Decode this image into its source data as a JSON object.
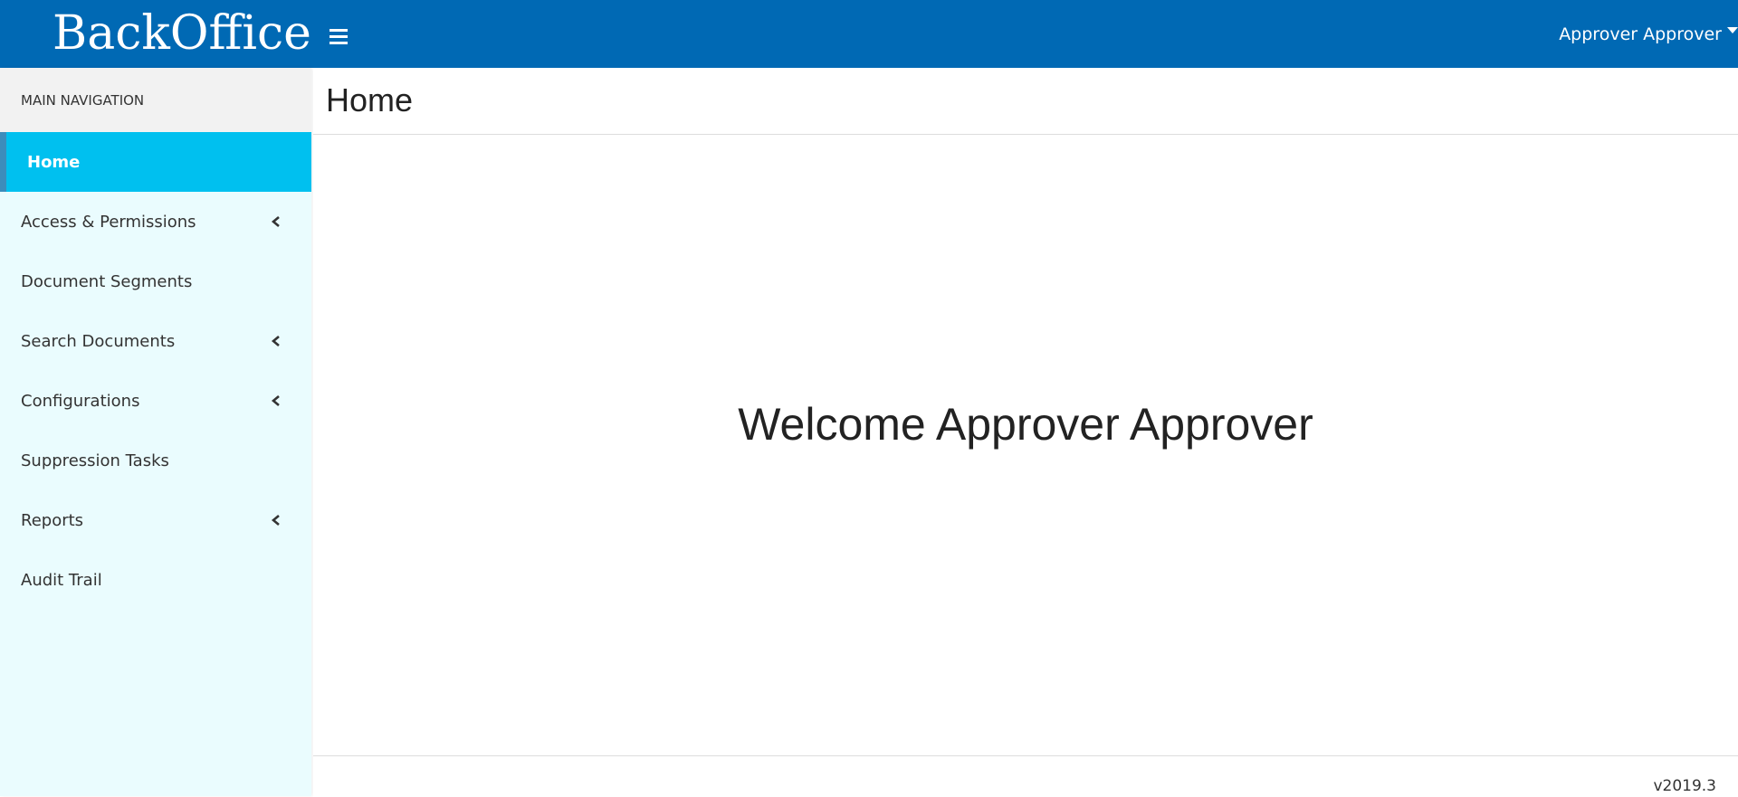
{
  "app": {
    "brand": "BackOffice",
    "user_name": "Approver Approver"
  },
  "colors": {
    "topbar": "#0069b4",
    "sidebar_bg": "#eafcfe",
    "active_item": "#00c0ef",
    "active_border": "#3c8dbc"
  },
  "icons": {
    "menu_toggle": "hamburger-icon",
    "user_dropdown": "caret-down-icon",
    "expand": "chevron-left-icon"
  },
  "sidebar": {
    "header": "MAIN NAVIGATION",
    "items": [
      {
        "label": "Home",
        "active": true,
        "expandable": false
      },
      {
        "label": "Access & Permissions",
        "active": false,
        "expandable": true
      },
      {
        "label": "Document Segments",
        "active": false,
        "expandable": false
      },
      {
        "label": "Search Documents",
        "active": false,
        "expandable": true
      },
      {
        "label": "Configurations",
        "active": false,
        "expandable": true
      },
      {
        "label": "Suppression Tasks",
        "active": false,
        "expandable": false
      },
      {
        "label": "Reports",
        "active": false,
        "expandable": true
      },
      {
        "label": "Audit Trail",
        "active": false,
        "expandable": false
      }
    ]
  },
  "main": {
    "title": "Home",
    "welcome": "Welcome Approver Approver"
  },
  "footer": {
    "version": "v2019.3"
  }
}
